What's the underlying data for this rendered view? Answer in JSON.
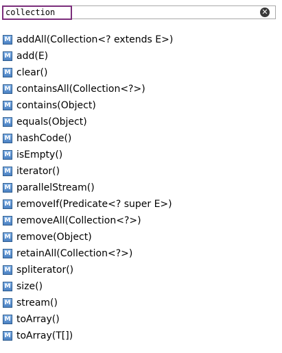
{
  "search": {
    "value": "collection",
    "clear_glyph": "✕"
  },
  "icon_letter": "M",
  "icon_name": "method-icon",
  "items": [
    {
      "label": "addAll(Collection<? extends E>)"
    },
    {
      "label": "add(E)"
    },
    {
      "label": "clear()"
    },
    {
      "label": "containsAll(Collection<?>)"
    },
    {
      "label": "contains(Object)"
    },
    {
      "label": "equals(Object)"
    },
    {
      "label": "hashCode()"
    },
    {
      "label": "isEmpty()"
    },
    {
      "label": "iterator()"
    },
    {
      "label": "parallelStream()"
    },
    {
      "label": "removeIf(Predicate<? super E>)"
    },
    {
      "label": "removeAll(Collection<?>)"
    },
    {
      "label": "remove(Object)"
    },
    {
      "label": "retainAll(Collection<?>)"
    },
    {
      "label": "spliterator()"
    },
    {
      "label": "size()"
    },
    {
      "label": "stream()"
    },
    {
      "label": "toArray()"
    },
    {
      "label": "toArray(T[])"
    }
  ]
}
